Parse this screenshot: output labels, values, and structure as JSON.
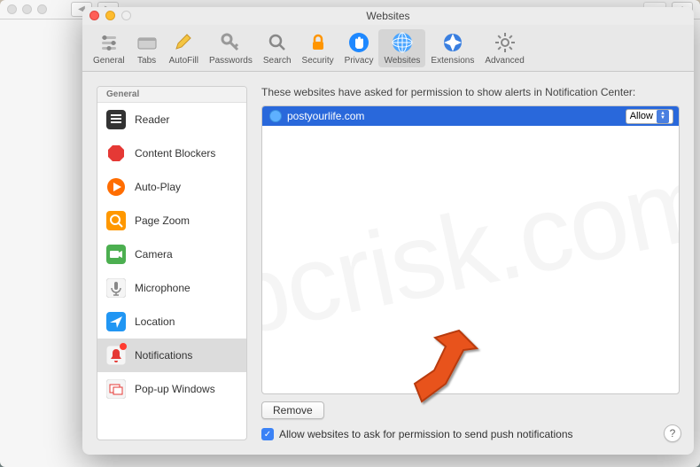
{
  "window": {
    "title": "Websites"
  },
  "toolbar": {
    "items": [
      {
        "label": "General",
        "icon": "switches"
      },
      {
        "label": "Tabs",
        "icon": "tab"
      },
      {
        "label": "AutoFill",
        "icon": "pencil"
      },
      {
        "label": "Passwords",
        "icon": "key"
      },
      {
        "label": "Search",
        "icon": "search"
      },
      {
        "label": "Security",
        "icon": "lock"
      },
      {
        "label": "Privacy",
        "icon": "hand"
      },
      {
        "label": "Websites",
        "icon": "globe",
        "selected": true
      },
      {
        "label": "Extensions",
        "icon": "puzzle"
      },
      {
        "label": "Advanced",
        "icon": "gear"
      }
    ]
  },
  "sidebar": {
    "header": "General",
    "items": [
      {
        "label": "Reader",
        "icon": "reader"
      },
      {
        "label": "Content Blockers",
        "icon": "stop"
      },
      {
        "label": "Auto-Play",
        "icon": "play"
      },
      {
        "label": "Page Zoom",
        "icon": "zoom"
      },
      {
        "label": "Camera",
        "icon": "camera"
      },
      {
        "label": "Microphone",
        "icon": "mic"
      },
      {
        "label": "Location",
        "icon": "location"
      },
      {
        "label": "Notifications",
        "icon": "notif",
        "selected": true,
        "badge": true
      },
      {
        "label": "Pop-up Windows",
        "icon": "popwin"
      }
    ]
  },
  "main": {
    "instruction": "These websites have asked for permission to show alerts in Notification Center:",
    "sites": [
      {
        "domain": "postyourlife.com",
        "permission": "Allow"
      }
    ],
    "remove_label": "Remove",
    "checkbox_label": "Allow websites to ask for permission to send push notifications",
    "checkbox_checked": true
  },
  "help": "?"
}
